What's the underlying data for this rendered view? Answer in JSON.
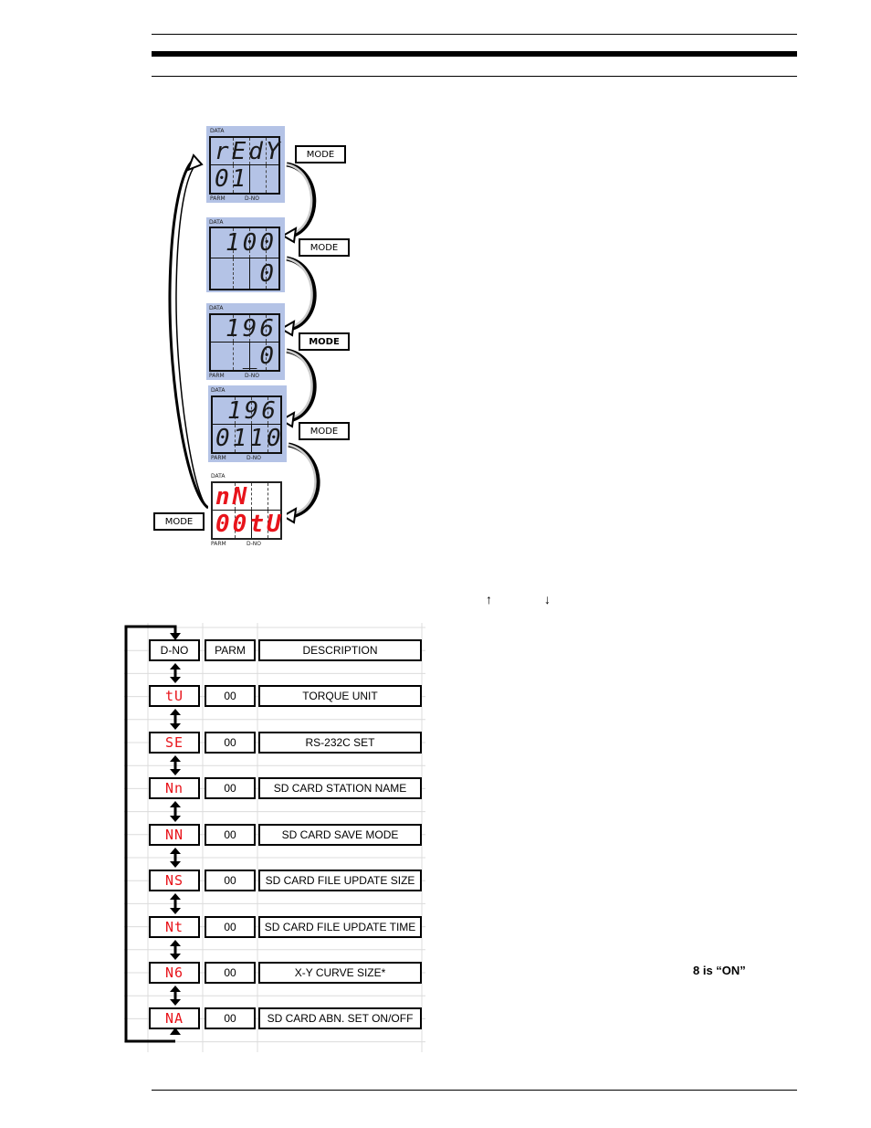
{
  "page": {
    "header_rules": [
      "thin",
      "thick",
      "thin"
    ],
    "footer_rule": "thin"
  },
  "mode_flow": {
    "button_label": "MODE",
    "screens": [
      {
        "style": "lcd",
        "data_label": "DATA",
        "top_digits": "rEdY",
        "bottom_digits": "01",
        "parm_label": "PARM",
        "dno_label": "D-NO"
      },
      {
        "style": "lcd",
        "data_label": "DATA",
        "top_digits": "100",
        "bottom_digits": "0",
        "parm_label": "",
        "dno_label": ""
      },
      {
        "style": "lcd",
        "data_label": "DATA",
        "top_digits": "196",
        "bottom_digits": "_0",
        "parm_label": "PARM",
        "dno_label": "D-NO"
      },
      {
        "style": "lcd",
        "data_label": "DATA",
        "top_digits": "196",
        "bottom_digits": "0110",
        "parm_label": "PARM",
        "dno_label": "D-NO"
      },
      {
        "style": "led-red",
        "data_label": "DATA",
        "top_digits": "nN",
        "bottom_digits": "00tU",
        "parm_label": "PARM",
        "dno_label": "D-NO"
      }
    ],
    "mode_buttons": [
      {
        "label": "MODE",
        "bold": false
      },
      {
        "label": "MODE",
        "bold": false
      },
      {
        "label": "MODE",
        "bold": true
      },
      {
        "label": "MODE",
        "bold": false
      },
      {
        "label": "MODE",
        "bold": false
      }
    ]
  },
  "arrow_keys": {
    "up": "↑",
    "down": "↓"
  },
  "parameter_table": {
    "headers": {
      "dno": "D-NO",
      "parm": "PARM",
      "description": "DESCRIPTION"
    },
    "rows": [
      {
        "dno": "tU",
        "parm": "00",
        "description": "TORQUE UNIT"
      },
      {
        "dno": "SE",
        "parm": "00",
        "description": "RS-232C SET"
      },
      {
        "dno": "Nn",
        "parm": "00",
        "description": "SD CARD STATION NAME"
      },
      {
        "dno": "NN",
        "parm": "00",
        "description": "SD CARD SAVE MODE"
      },
      {
        "dno": "NS",
        "parm": "00",
        "description": "SD CARD FILE UPDATE SIZE"
      },
      {
        "dno": "Nt",
        "parm": "00",
        "description": "SD CARD FILE UPDATE TIME"
      },
      {
        "dno": "N6",
        "parm": "00",
        "description": "X-Y CURVE SIZE*"
      },
      {
        "dno": "NA",
        "parm": "00",
        "description": "SD CARD ABN. SET ON/OFF"
      }
    ]
  },
  "side_note": "8 is “ON”",
  "colors": {
    "lcd_bg": "#b4c3e6",
    "led_red": "#e8141b"
  }
}
